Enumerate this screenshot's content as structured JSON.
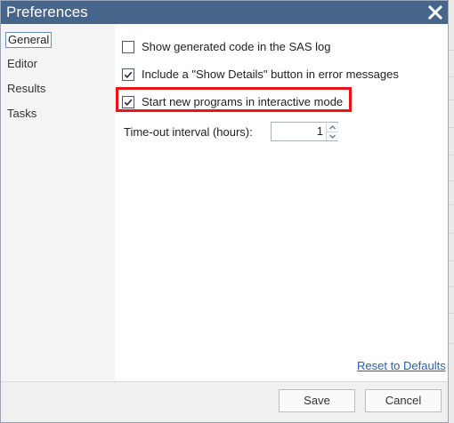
{
  "dialog": {
    "title": "Preferences",
    "close_glyph": "✕"
  },
  "sidebar": {
    "items": [
      {
        "label": "General",
        "selected": true
      },
      {
        "label": "Editor",
        "selected": false
      },
      {
        "label": "Results",
        "selected": false
      },
      {
        "label": "Tasks",
        "selected": false
      }
    ]
  },
  "general": {
    "options": [
      {
        "label": "Show generated code in the SAS log",
        "checked": false
      },
      {
        "label": "Include a \"Show Details\" button in error messages",
        "checked": true
      },
      {
        "label": "Start new programs in interactive mode",
        "checked": true,
        "highlighted": true
      }
    ],
    "timeout": {
      "label": "Time-out interval (hours):",
      "value": "1"
    },
    "reset_label": "Reset to Defaults"
  },
  "footer": {
    "save_label": "Save",
    "cancel_label": "Cancel"
  },
  "colors": {
    "titlebar": "#47648b",
    "highlight": "#e8141a",
    "link": "#2b5ea8"
  },
  "icons": {
    "close": "close-icon",
    "check": "checkmark-icon",
    "spin_up": "chevron-up-icon",
    "spin_down": "chevron-down-icon"
  }
}
